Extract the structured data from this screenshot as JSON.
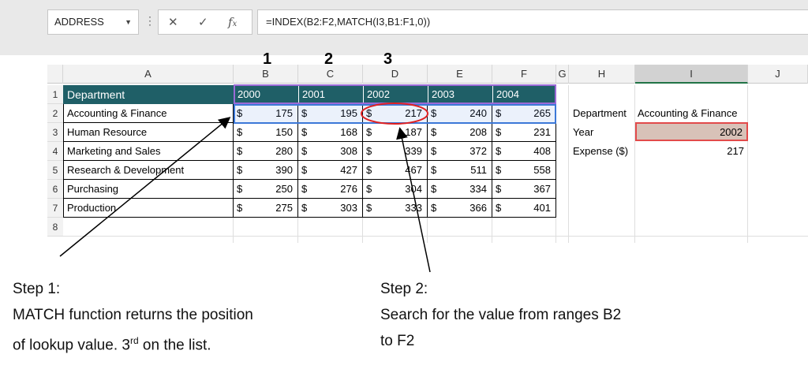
{
  "name_box": "ADDRESS",
  "formula": "=INDEX(B2:F2,MATCH(I3,B1:F1,0))",
  "column_numbers": [
    "1",
    "2",
    "3"
  ],
  "columns": [
    "A",
    "B",
    "C",
    "D",
    "E",
    "F",
    "G",
    "H",
    "I",
    "J"
  ],
  "rows": [
    "1",
    "2",
    "3",
    "4",
    "5",
    "6",
    "7",
    "8"
  ],
  "table": {
    "header": [
      "Department",
      "2000",
      "2001",
      "2002",
      "2003",
      "2004"
    ],
    "currency": "$",
    "rows": [
      {
        "dept": "Accounting & Finance",
        "values": [
          "175",
          "195",
          "217",
          "240",
          "265"
        ]
      },
      {
        "dept": "Human Resource",
        "values": [
          "150",
          "168",
          "187",
          "208",
          "231"
        ]
      },
      {
        "dept": "Marketing and Sales",
        "values": [
          "280",
          "308",
          "339",
          "372",
          "408"
        ]
      },
      {
        "dept": "Research & Development",
        "values": [
          "390",
          "427",
          "467",
          "511",
          "558"
        ]
      },
      {
        "dept": "Purchasing",
        "values": [
          "250",
          "276",
          "304",
          "334",
          "367"
        ]
      },
      {
        "dept": "Production",
        "values": [
          "275",
          "303",
          "333",
          "366",
          "401"
        ]
      }
    ]
  },
  "lookup": {
    "department_label": "Department",
    "department_value": "Accounting & Finance",
    "year_label": "Year",
    "year_value": "2002",
    "expense_label": "Expense ($)",
    "expense_value": "217"
  },
  "step1": {
    "title": "Step 1:",
    "line1": "MATCH function returns the position",
    "line2_pre": "of lookup value. 3",
    "line2_sup": "rd",
    "line2_post": " on the list."
  },
  "step2": {
    "title": "Step 2:",
    "line1": "Search for the value from ranges B2",
    "line2": "to F2"
  },
  "colors": {
    "header_fill": "#1f5f67",
    "highlight_cell": "#d8c2b8",
    "annotation_circle": "#e02020",
    "select_blue": "#3c78d8"
  }
}
